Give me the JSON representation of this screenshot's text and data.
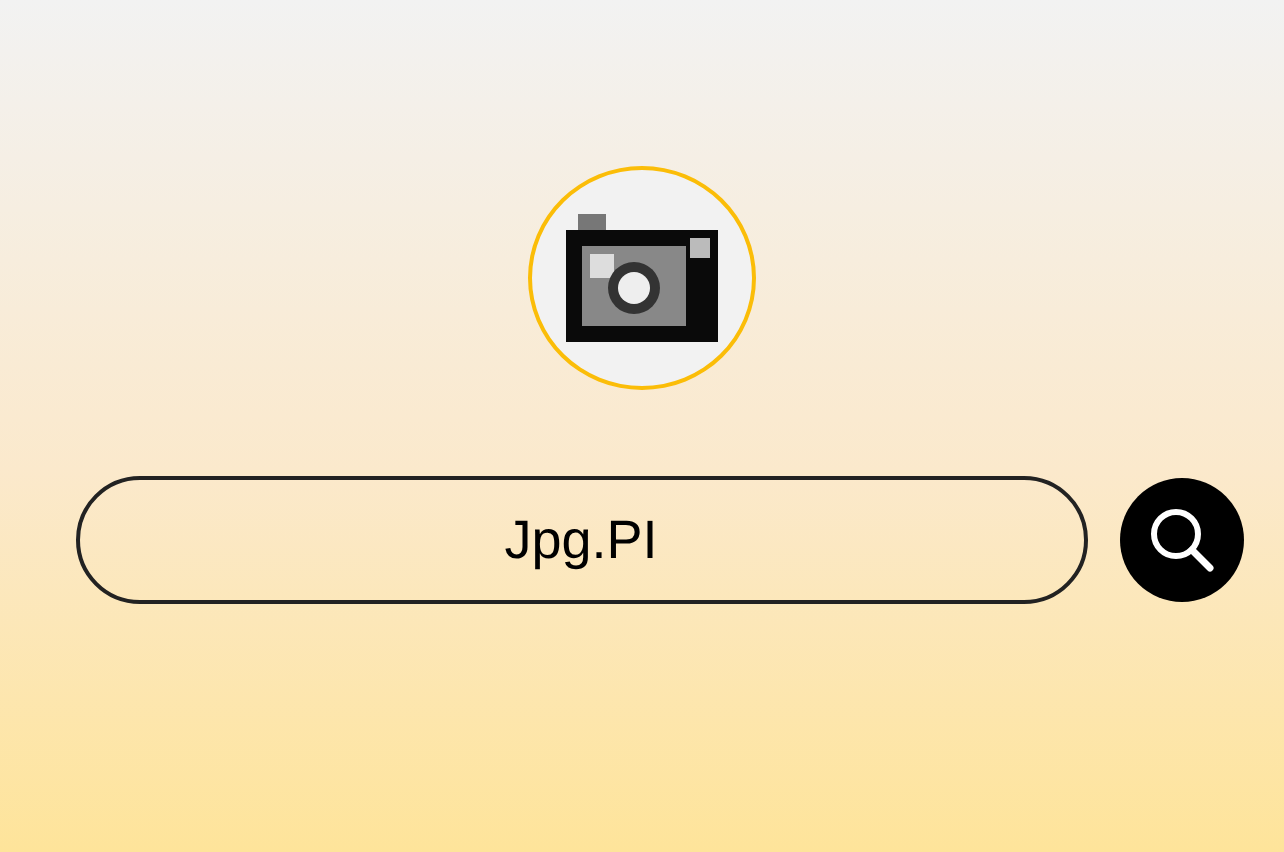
{
  "search": {
    "value": "Jpg.PI"
  }
}
